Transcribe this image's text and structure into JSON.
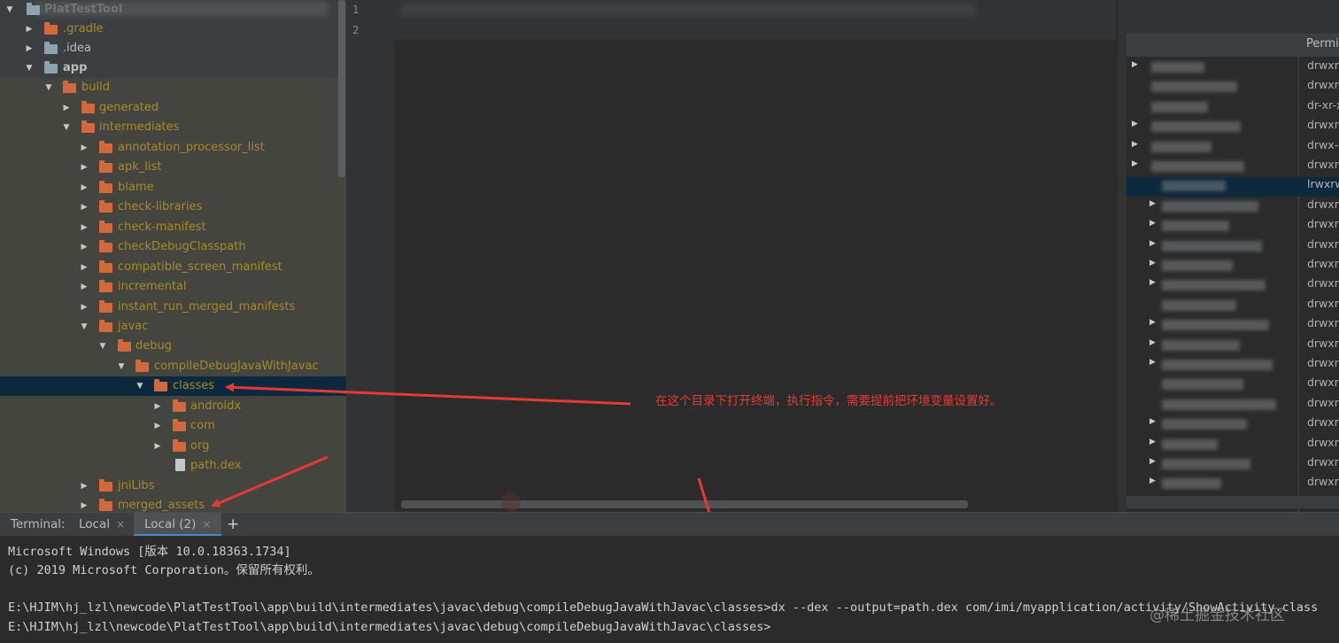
{
  "tree": {
    "root_label": "PlatTestTool",
    "rows": [
      {
        "label": ".gradle",
        "icon": "folder-icon"
      },
      {
        "label": ".idea",
        "icon": "folder-icon"
      },
      {
        "label": "app",
        "icon": "module-folder-icon"
      },
      {
        "label": "build",
        "icon": "folder-icon"
      },
      {
        "label": "generated",
        "icon": "folder-icon"
      },
      {
        "label": "intermediates",
        "icon": "folder-icon"
      },
      {
        "label": "annotation_processor_list",
        "icon": "folder-icon"
      },
      {
        "label": "apk_list",
        "icon": "folder-icon"
      },
      {
        "label": "blame",
        "icon": "folder-icon"
      },
      {
        "label": "check-libraries",
        "icon": "folder-icon"
      },
      {
        "label": "check-manifest",
        "icon": "folder-icon"
      },
      {
        "label": "checkDebugClasspath",
        "icon": "folder-icon"
      },
      {
        "label": "compatible_screen_manifest",
        "icon": "folder-icon"
      },
      {
        "label": "incremental",
        "icon": "folder-icon"
      },
      {
        "label": "instant_run_merged_manifests",
        "icon": "folder-icon"
      },
      {
        "label": "javac",
        "icon": "folder-icon"
      },
      {
        "label": "debug",
        "icon": "folder-icon"
      },
      {
        "label": "compileDebugJavaWithJavac",
        "icon": "folder-icon"
      },
      {
        "label": "classes",
        "icon": "folder-icon"
      },
      {
        "label": "androidx",
        "icon": "folder-icon"
      },
      {
        "label": "com",
        "icon": "folder-icon"
      },
      {
        "label": "org",
        "icon": "folder-icon"
      },
      {
        "label": "path.dex",
        "icon": "file-icon"
      },
      {
        "label": "jniLibs",
        "icon": "folder-icon"
      },
      {
        "label": "merged_assets",
        "icon": "folder-icon"
      }
    ]
  },
  "editor": {
    "line_numbers": [
      "1",
      "2"
    ]
  },
  "right_panel": {
    "header_permissions": "Permi...",
    "permissions": [
      "drwxr-",
      "drwxr-",
      "dr-xr-x",
      "drwxr-",
      "drwx--",
      "drwxr-",
      "lrwxrw",
      "drwxrw",
      "drwxrw",
      "drwxrw",
      "drwxrw",
      "drwxrw",
      "drwxrw",
      "drwxrw",
      "drwxrw",
      "drwxrw",
      "drwxrw",
      "drwxrw",
      "drwxrw",
      "drwxrw",
      "drwxrw",
      "drwxrw"
    ]
  },
  "annotation": {
    "text": "在这个目录下打开终端，执行指令，需要提前把环境变量设置好。",
    "color": "#e53935"
  },
  "terminal_tabs": {
    "title": "Terminal:",
    "tabs": [
      "Local",
      "Local (2)"
    ],
    "close_glyph": "×",
    "add_glyph": "+"
  },
  "terminal": {
    "lines": [
      "Microsoft Windows [版本 10.0.18363.1734]",
      "(c) 2019 Microsoft Corporation。保留所有权利。",
      "",
      "E:\\HJIM\\hj_lzl\\newcode\\PlatTestTool\\app\\build\\intermediates\\javac\\debug\\compileDebugJavaWithJavac\\classes>dx --dex --output=path.dex com/imi/myapplication/activity/ShowActivity.class",
      "E:\\HJIM\\hj_lzl\\newcode\\PlatTestTool\\app\\build\\intermediates\\javac\\debug\\compileDebugJavaWithJavac\\classes>"
    ]
  },
  "watermark": "@稀土掘金技术社区",
  "colors": {
    "folder": "#d3683c",
    "excluded_text": "#a68a28",
    "selection": "#0d293e",
    "accent_tab": "#4a88c7"
  }
}
